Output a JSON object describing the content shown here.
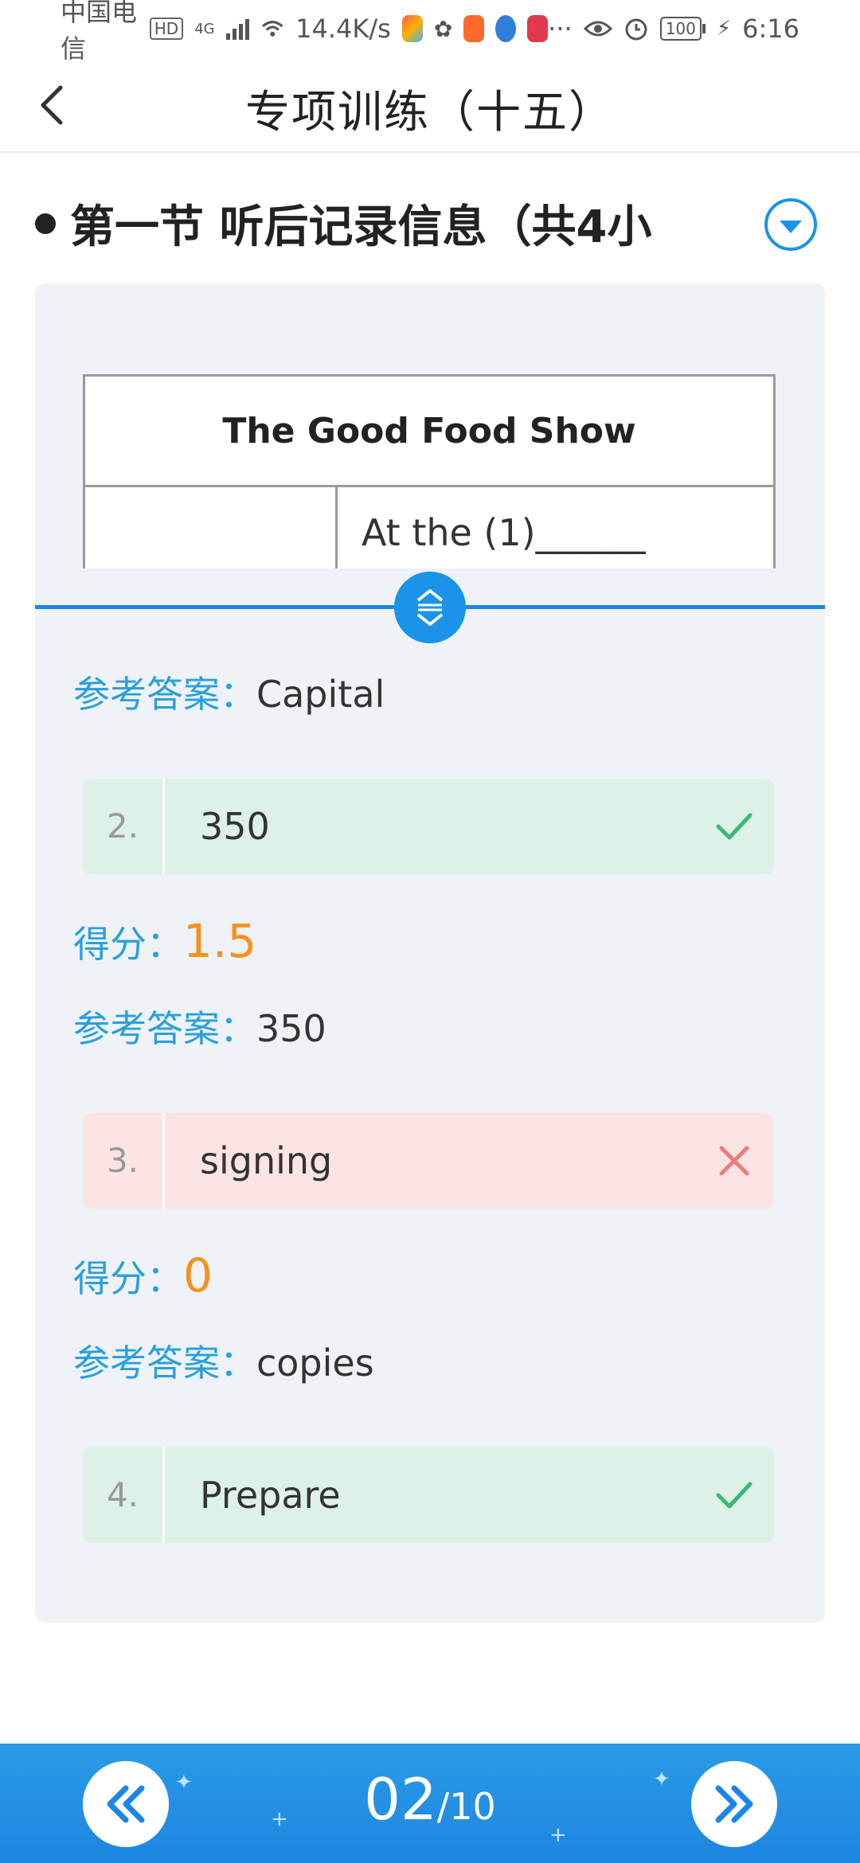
{
  "status_bar": {
    "carrier": "中国电信",
    "hd": "HD",
    "network": "4G",
    "speed": "14.4K/s",
    "more": "···",
    "battery": "100",
    "time": "6:16"
  },
  "header": {
    "title": "专项训练（十五）"
  },
  "section": {
    "title": "第一节 听后记录信息（共4小"
  },
  "passage": {
    "table_title": "The Good Food Show",
    "row1_right": "At the (1)______"
  },
  "answers": {
    "key_label": "参考答案：",
    "score_label": "得分：",
    "q1": {
      "reference": "Capital"
    },
    "q2": {
      "number": "2.",
      "response": "350",
      "result": "correct",
      "score": "1.5",
      "reference": "350"
    },
    "q3": {
      "number": "3.",
      "response": "signing",
      "result": "wrong",
      "score": "0",
      "reference": "copies"
    },
    "q4": {
      "number": "4.",
      "response": "Prepare",
      "result": "correct"
    }
  },
  "pager": {
    "current": "02",
    "separator": "/",
    "total": "10"
  },
  "colors": {
    "accent": "#1a86e8",
    "score": "#f5931e",
    "correct_bg": "#ddf1e7",
    "wrong_bg": "#fde4e4",
    "correct_mark": "#3cb878",
    "wrong_mark": "#f07a7a"
  },
  "icons": {
    "back": "chevron-left-icon",
    "dropdown": "caret-down-circle-icon",
    "handle": "drag-handle-icon",
    "correct": "checkmark-icon",
    "wrong": "cross-icon",
    "prev": "double-chevron-left-icon",
    "next": "double-chevron-right-icon"
  }
}
